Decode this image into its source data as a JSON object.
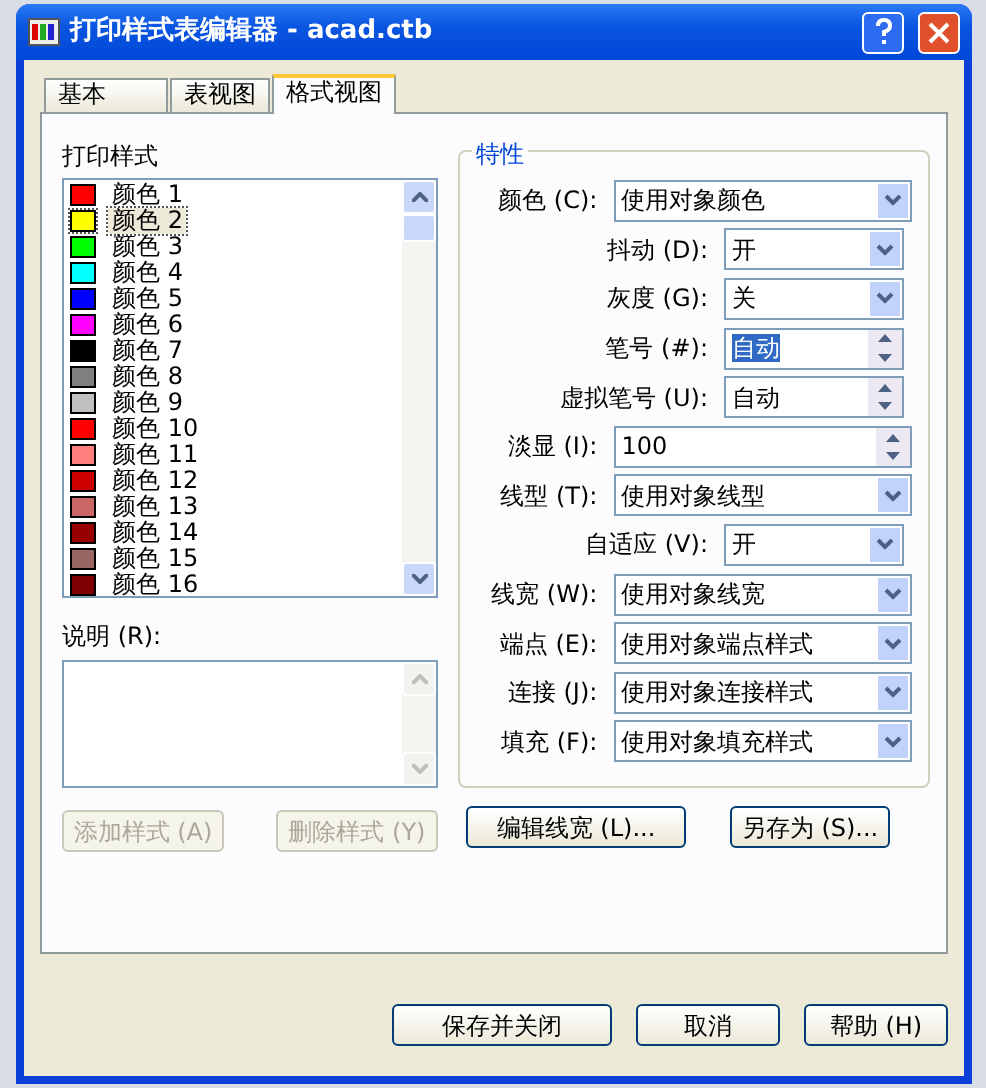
{
  "window": {
    "title": "打印样式表编辑器 - acad.ctb"
  },
  "tabs": [
    {
      "label": "基本",
      "selected": false
    },
    {
      "label": "表视图",
      "selected": false
    },
    {
      "label": "格式视图",
      "selected": true
    }
  ],
  "styles": {
    "label": "打印样式",
    "items": [
      {
        "name": "颜色 1",
        "color": "#ff0000",
        "selected": false
      },
      {
        "name": "颜色 2",
        "color": "#ffff00",
        "selected": true
      },
      {
        "name": "颜色 3",
        "color": "#00ff00",
        "selected": false
      },
      {
        "name": "颜色 4",
        "color": "#00ffff",
        "selected": false
      },
      {
        "name": "颜色 5",
        "color": "#0000ff",
        "selected": false
      },
      {
        "name": "颜色 6",
        "color": "#ff00ff",
        "selected": false
      },
      {
        "name": "颜色 7",
        "color": "#000000",
        "selected": false
      },
      {
        "name": "颜色 8",
        "color": "#808080",
        "selected": false
      },
      {
        "name": "颜色 9",
        "color": "#c0c0c0",
        "selected": false
      },
      {
        "name": "颜色 10",
        "color": "#ff0000",
        "selected": false
      },
      {
        "name": "颜色 11",
        "color": "#ff7f7f",
        "selected": false
      },
      {
        "name": "颜色 12",
        "color": "#cc0000",
        "selected": false
      },
      {
        "name": "颜色 13",
        "color": "#cc6666",
        "selected": false
      },
      {
        "name": "颜色 14",
        "color": "#990000",
        "selected": false
      },
      {
        "name": "颜色 15",
        "color": "#996666",
        "selected": false
      },
      {
        "name": "颜色 16",
        "color": "#7f0000",
        "selected": false
      }
    ]
  },
  "description": {
    "label": "说明 (R):"
  },
  "style_buttons": [
    {
      "label": "添加样式 (A)",
      "disabled": true
    },
    {
      "label": "删除样式 (Y)",
      "disabled": true
    }
  ],
  "properties": {
    "title": "特性",
    "rows": [
      {
        "label": "颜色 (C):",
        "value": "使用对象颜色",
        "kind": "combo",
        "sub": false,
        "selected": false
      },
      {
        "label": "抖动 (D):",
        "value": "开",
        "kind": "combo",
        "sub": true,
        "selected": false
      },
      {
        "label": "灰度 (G):",
        "value": "关",
        "kind": "combo",
        "sub": true,
        "selected": false
      },
      {
        "label": "笔号 (#):",
        "value": "自动",
        "kind": "spin",
        "sub": true,
        "selected": true
      },
      {
        "label": "虚拟笔号 (U):",
        "value": "自动",
        "kind": "spin",
        "sub": true,
        "selected": false
      },
      {
        "label": "淡显 (I):",
        "value": "100",
        "kind": "spin",
        "sub": false,
        "selected": false
      },
      {
        "label": "线型 (T):",
        "value": "使用对象线型",
        "kind": "combo",
        "sub": false,
        "selected": false
      },
      {
        "label": "自适应 (V):",
        "value": "开",
        "kind": "combo",
        "sub": true,
        "selected": false
      },
      {
        "label": "线宽 (W):",
        "value": "使用对象线宽",
        "kind": "combo",
        "sub": false,
        "selected": false
      },
      {
        "label": "端点 (E):",
        "value": "使用对象端点样式",
        "kind": "combo",
        "sub": false,
        "selected": false
      },
      {
        "label": "连接 (J):",
        "value": "使用对象连接样式",
        "kind": "combo",
        "sub": false,
        "selected": false
      },
      {
        "label": "填充 (F):",
        "value": "使用对象填充样式",
        "kind": "combo",
        "sub": false,
        "selected": false
      }
    ]
  },
  "panel_buttons": [
    "编辑线宽 (L)...",
    "另存为 (S)..."
  ],
  "footer_buttons": [
    "保存并关闭",
    "取消",
    "帮助 (H)"
  ]
}
